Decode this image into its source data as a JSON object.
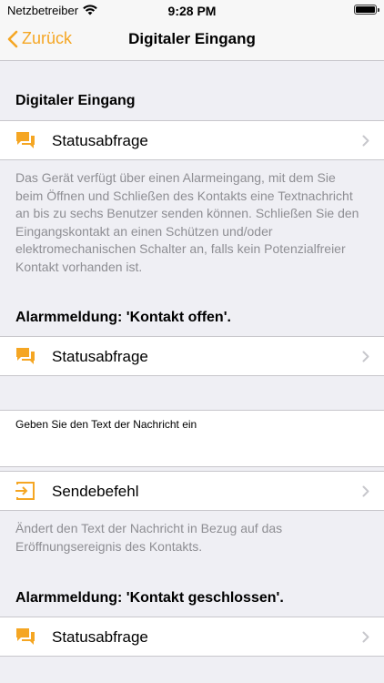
{
  "status_bar": {
    "carrier": "Netzbetreiber",
    "time": "9:28 PM"
  },
  "nav": {
    "back_label": "Zurück",
    "title": "Digitaler Eingang"
  },
  "colors": {
    "accent": "#f5a623"
  },
  "sections": [
    {
      "header": "Digitaler Eingang"
    },
    {
      "header": "Alarmmeldung: 'Kontakt offen'."
    },
    {
      "header": "Alarmmeldung: 'Kontakt geschlossen'."
    }
  ],
  "cells": {
    "status_query_label": "Statusabfrage",
    "send_command_label": "Sendebefehl",
    "message_input_prompt": "Geben Sie den Text der Nachricht ein"
  },
  "icons": {
    "chat": "chat-bubbles-icon",
    "send": "input-arrow-icon",
    "chevron": "chevron-right-icon"
  },
  "footnotes": {
    "digital_input": "Das Gerät verfügt über einen Alarmeingang, mit dem Sie beim Öffnen und Schließen des Kontakts eine Textnachricht an bis zu sechs Benutzer senden können. Schließen Sie den Eingangskontakt an einen Schützen und/oder elektromechanischen Schalter an, falls kein Potenzialfreier Kontakt vorhanden ist.",
    "send_command": "Ändert den Text der Nachricht in Bezug auf das Eröffnungsereignis des Kontakts."
  }
}
